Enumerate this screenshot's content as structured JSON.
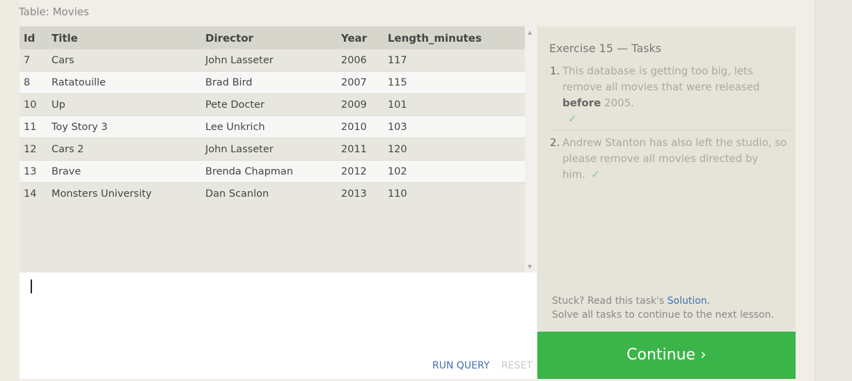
{
  "table_label": "Table: Movies",
  "results": {
    "columns": [
      "Id",
      "Title",
      "Director",
      "Year",
      "Length_minutes"
    ],
    "rows": [
      [
        "7",
        "Cars",
        "John Lasseter",
        "2006",
        "117"
      ],
      [
        "8",
        "Ratatouille",
        "Brad Bird",
        "2007",
        "115"
      ],
      [
        "10",
        "Up",
        "Pete Docter",
        "2009",
        "101"
      ],
      [
        "11",
        "Toy Story 3",
        "Lee Unkrich",
        "2010",
        "103"
      ],
      [
        "12",
        "Cars 2",
        "John Lasseter",
        "2011",
        "120"
      ],
      [
        "13",
        "Brave",
        "Brenda Chapman",
        "2012",
        "102"
      ],
      [
        "14",
        "Monsters University",
        "Dan Scanlon",
        "2013",
        "110"
      ]
    ]
  },
  "editor": {
    "run_label": "RUN QUERY",
    "reset_label": "RESET"
  },
  "tasks": {
    "title": "Exercise 15 — Tasks",
    "items": [
      {
        "num": "1.",
        "text_before": "This database is getting too big, lets remove all movies that were released ",
        "bold": "before",
        "text_after": " 2005.",
        "check": "✓"
      },
      {
        "num": "2.",
        "text_before": "Andrew Stanton has also left the studio, so please remove all movies directed by him.",
        "bold": "",
        "text_after": "",
        "check": "✓"
      }
    ],
    "stuck_prefix": "Stuck? Read this task's ",
    "solution_link": "Solution.",
    "solve_all": "Solve all tasks to continue to the next lesson."
  },
  "continue_label": "Continue ›",
  "colors": {
    "accent_green": "#3bb54a",
    "link_blue": "#3f6fb3",
    "check_green": "#8bc38b"
  }
}
